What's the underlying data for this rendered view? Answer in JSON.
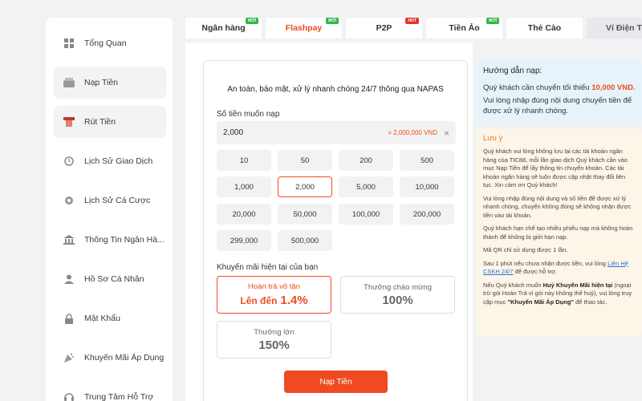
{
  "sidebar": {
    "items": [
      {
        "label": "Tổng Quan",
        "icon": "grid-icon"
      },
      {
        "label": "Nạp Tiền",
        "icon": "deposit-icon"
      },
      {
        "label": "Rút Tiền",
        "icon": "withdraw-icon"
      },
      {
        "label": "Lịch Sử Giao Dịch",
        "icon": "clock-icon"
      },
      {
        "label": "Lịch Sử Cá Cược",
        "icon": "bet-history-icon"
      },
      {
        "label": "Thông Tin Ngân Hà...",
        "icon": "bank-icon"
      },
      {
        "label": "Hồ Sơ Cá Nhân",
        "icon": "user-icon"
      },
      {
        "label": "Mật Khẩu",
        "icon": "lock-icon"
      },
      {
        "label": "Khuyến Mãi Áp Dụng",
        "icon": "promo-icon"
      },
      {
        "label": "Trung Tâm Hỗ Trợ",
        "icon": "support-icon"
      }
    ]
  },
  "tabs": [
    {
      "label": "Ngân hàng",
      "badge": "MỚI"
    },
    {
      "label": "Flashpay",
      "badge": "MỚI"
    },
    {
      "label": "P2P",
      "badge": "HOT"
    },
    {
      "label": "Tiền Ảo",
      "badge": "MỚI"
    },
    {
      "label": "Thẻ Cào",
      "badge": ""
    },
    {
      "label": "Ví Điện Tử",
      "badge": ""
    }
  ],
  "form": {
    "title": "An toàn, bảo mật, xử lý nhanh chóng 24/7 thông qua NAPAS",
    "amount_label": "Số tiền muốn nạp",
    "amount_value": "2,000",
    "amount_converted": "= 2,000,000 VND",
    "clear_icon": "×",
    "amounts": [
      "10",
      "50",
      "200",
      "500",
      "1,000",
      "2,000",
      "5,000",
      "10,000",
      "20,000",
      "50,000",
      "100,000",
      "200,000",
      "299,000",
      "500,000"
    ],
    "selected_amount": "2,000",
    "promo_label": "Khuyến mãi hiện tại của bạn",
    "promos": {
      "p1_name": "Hoàn trả vô tận",
      "p1_prefix": "Lên đến",
      "p1_value": "1.4%",
      "p2_name": "Thưởng chào mừng",
      "p2_value": "100%",
      "p3_name": "Thưởng lớn",
      "p3_value": "150%"
    },
    "submit_label": "Nạp Tiền"
  },
  "guide": {
    "title": "Hướng dẫn nạp:",
    "line1_prefix": "Quý khách cần chuyển tối thiểu",
    "line1_highlight": "10,000 VND.",
    "line2": "Vui lòng nhập đúng nội dung chuyển tiền để được xử lý nhanh chóng."
  },
  "notice": {
    "title": "Lưu ý",
    "p1": "Quý khách vui lòng không lưu lại các tài khoản ngân hàng của TIC88, mỗi lần giao dịch Quý khách cần vào mục Nạp Tiền để lấy thông tin chuyển khoản. Các tài khoản ngân hàng sẽ luôn được cập nhật thay đổi liên tục. Xin cảm ơn Quý khách!",
    "p2": "Vui lòng nhập đúng nội dung và số tiền để được xử lý nhanh chóng, chuyển không đúng sẽ không nhận được tiền vào tài khoản.",
    "p3": "Quý khách hạn chế tạo nhiều phiếu nạp mà không hoàn thành để không bị giới hạn nạp.",
    "p4": "Mã QR chỉ sử dụng được 1 lần.",
    "p5_prefix": "Sau 1 phút nếu chưa nhận được tiền, vui lòng",
    "p5_link": "Liên Hệ CSKH 24/7",
    "p5_suffix": "để được hỗ trợ.",
    "p6_prefix": "Nếu Quý khách muốn",
    "p6_bold1": "Huỷ Khuyến Mãi hiện tại",
    "p6_mid": "(ngoại trừ gói Hoàn Trả vì gói này không thể huỷ), vui lòng truy cập mục",
    "p6_bold2": "\"Khuyến Mãi Áp Dụng\"",
    "p6_suffix": "để thao tác."
  },
  "colors": {
    "accent": "#f04a20",
    "guide_bg": "#e6f3fb",
    "notice_bg": "#fdf5e8",
    "badge_new": "#2fb54c",
    "badge_hot": "#e5342a"
  }
}
